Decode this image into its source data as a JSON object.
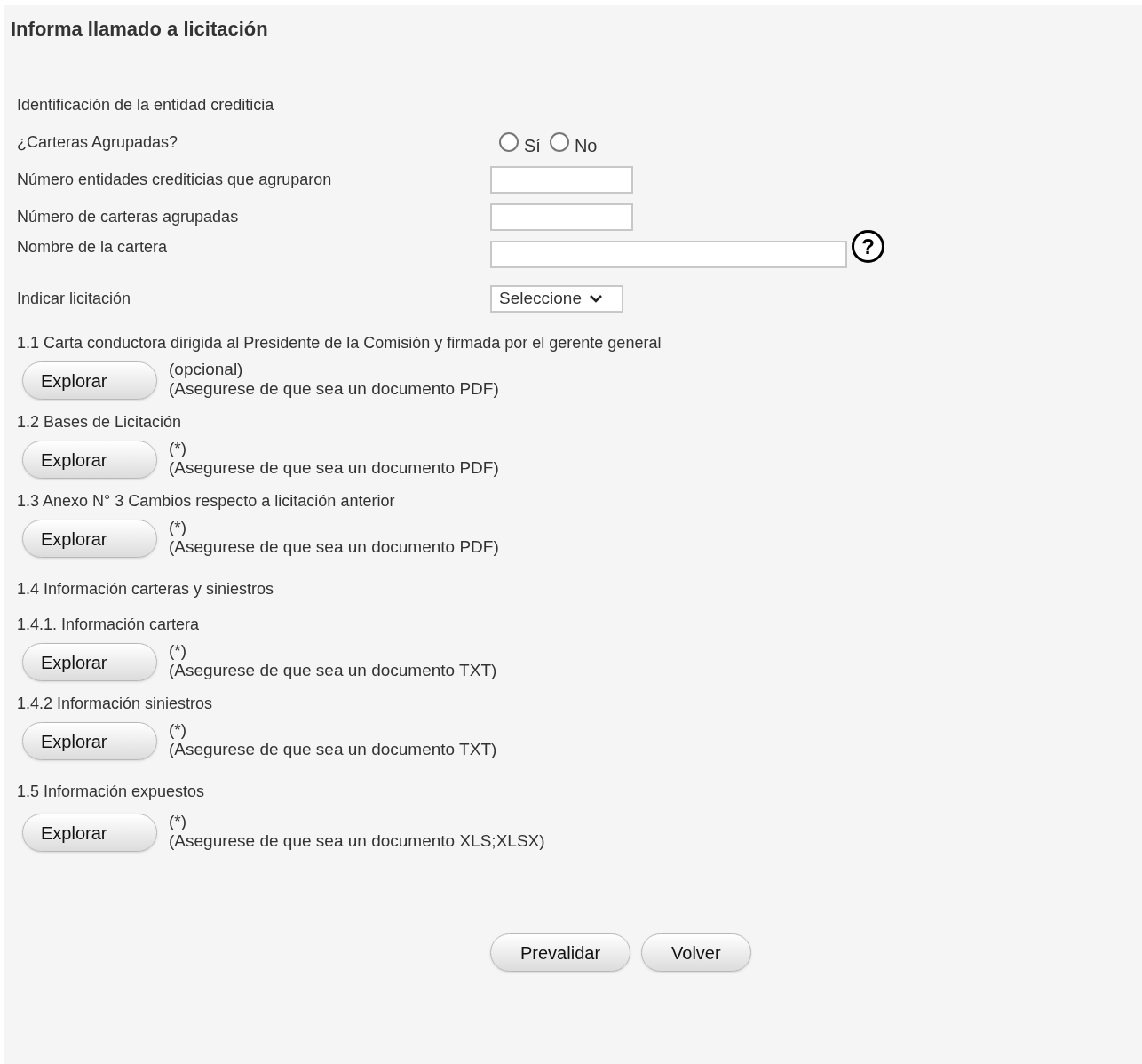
{
  "title": "Informa llamado a licitación",
  "form": [
    {
      "kind": "heading",
      "label": "Identificación de la entidad crediticia"
    },
    {
      "kind": "radio",
      "label": "¿Carteras Agrupadas?",
      "options": [
        {
          "label": "Sí",
          "selected": false
        },
        {
          "label": "No",
          "selected": false
        }
      ]
    },
    {
      "kind": "text",
      "label": "Número entidades crediticias que agruparon"
    },
    {
      "kind": "text",
      "label": "Número de carteras agrupadas"
    },
    {
      "kind": "wide",
      "label": "Nombre de la cartera",
      "help": "?"
    },
    {
      "kind": "select",
      "label": "Indicar licitación",
      "value": "Seleccione"
    }
  ],
  "uploads": [
    {
      "kind": "label",
      "label": "1.1 Carta conductora dirigida al Presidente de la Comisión y firmada por el gerente general"
    },
    {
      "kind": "file",
      "button": "Explorar",
      "note": "(opcional)",
      "hint": "(Asegurese de que sea un documento PDF)"
    },
    {
      "kind": "label",
      "label": "1.2 Bases de Licitación"
    },
    {
      "kind": "file",
      "button": "Explorar",
      "note": "(*)",
      "hint": "(Asegurese de que sea un documento PDF)"
    },
    {
      "kind": "label",
      "label": "1.3 Anexo N° 3 Cambios respecto a licitación anterior"
    },
    {
      "kind": "file",
      "button": "Explorar",
      "note": "(*)",
      "hint": "(Asegurese de que sea un documento PDF)"
    },
    {
      "kind": "section",
      "label": "1.4 Información carteras y siniestros"
    },
    {
      "kind": "label",
      "label": "1.4.1. Información cartera"
    },
    {
      "kind": "file",
      "button": "Explorar",
      "note": "(*)",
      "hint": "(Asegurese de que sea un documento TXT)"
    },
    {
      "kind": "label",
      "label": "1.4.2 Información siniestros"
    },
    {
      "kind": "file",
      "button": "Explorar",
      "note": "(*)",
      "hint": "(Asegurese de que sea un documento TXT)"
    },
    {
      "kind": "section",
      "label": "1.5 Información expuestos"
    },
    {
      "kind": "file",
      "button": "Explorar",
      "note": "(*)",
      "hint": "(Asegurese de que sea un documento XLS;XLSX)"
    }
  ],
  "actions": [
    "Prevalidar",
    "Volver"
  ]
}
